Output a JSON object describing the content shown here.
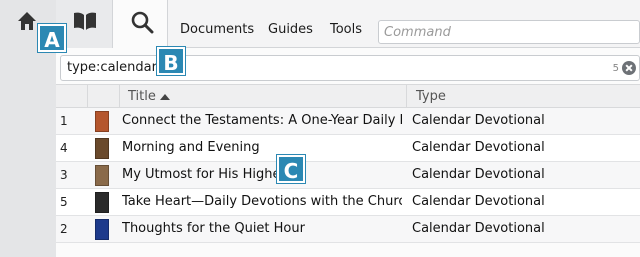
{
  "nav": {
    "home_icon": "home-icon",
    "library_icon": "book-icon",
    "search_icon": "search-icon"
  },
  "toolbar": {
    "tabs": [
      "Documents",
      "Guides",
      "Tools"
    ],
    "command_placeholder": "Command"
  },
  "query": {
    "value": "type:calendar",
    "count": "5"
  },
  "table": {
    "columns": [
      "Title",
      "Type"
    ],
    "rows": [
      {
        "num": "1",
        "title": "Connect the Testaments: A One-Year Daily Devot...",
        "type": "Calendar Devotional",
        "cover_color": "#b5562d"
      },
      {
        "num": "4",
        "title": "Morning and Evening",
        "type": "Calendar Devotional",
        "cover_color": "#6a4a2c"
      },
      {
        "num": "3",
        "title": "My Utmost for His Highest",
        "type": "Calendar Devotional",
        "cover_color": "#8a6a4a"
      },
      {
        "num": "5",
        "title": "Take Heart—Daily Devotions with the Church’s ...",
        "type": "Calendar Devotional",
        "cover_color": "#2a2a2a"
      },
      {
        "num": "2",
        "title": "Thoughts for the Quiet Hour",
        "type": "Calendar Devotional",
        "cover_color": "#1d3a8c"
      }
    ]
  },
  "callouts": [
    "A",
    "B",
    "C"
  ],
  "colors": {
    "callout": "#2b88b3"
  }
}
